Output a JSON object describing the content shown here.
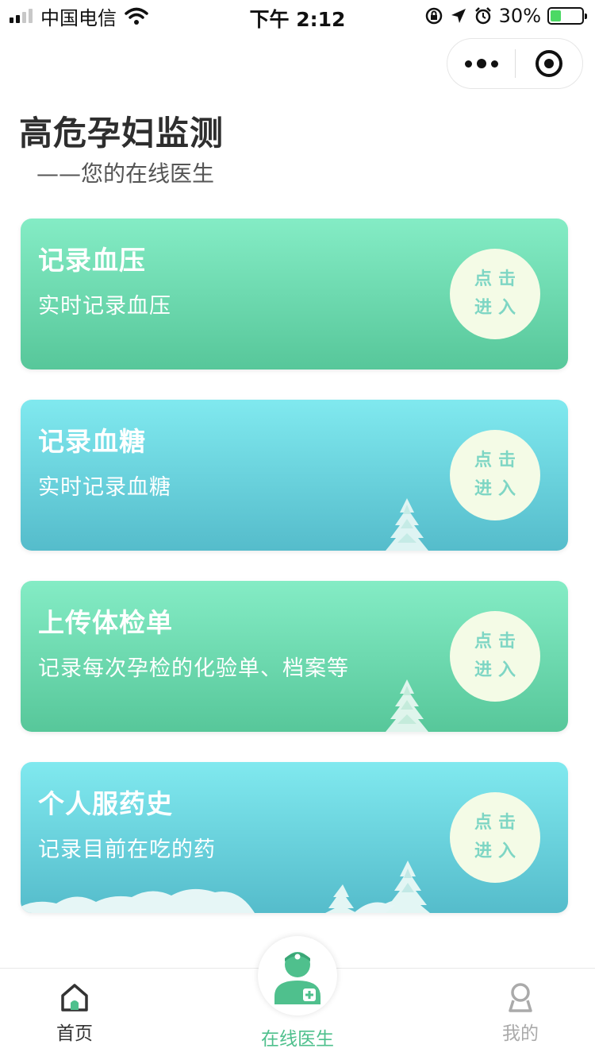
{
  "status_bar": {
    "carrier": "中国电信",
    "time": "下午 2:12",
    "battery": "30%",
    "battery_level": 0.3,
    "icons": [
      "signal-icon",
      "wifi-icon",
      "rotation-lock-icon",
      "location-icon",
      "alarm-icon",
      "battery-icon"
    ]
  },
  "capsule": {
    "icons": [
      "more-icon",
      "close-miniprogram-icon"
    ]
  },
  "header": {
    "title": "高危孕妇监测",
    "subtitle": "——您的在线医生"
  },
  "cards": [
    {
      "title": "记录血压",
      "desc": "实时记录血压",
      "btn_line1": "点击",
      "btn_line2": "进入",
      "color": "green"
    },
    {
      "title": "记录血糖",
      "desc": "实时记录血糖",
      "btn_line1": "点击",
      "btn_line2": "进入",
      "color": "blue"
    },
    {
      "title": "上传体检单",
      "desc": "记录每次孕检的化验单、档案等",
      "btn_line1": "点击",
      "btn_line2": "进入",
      "color": "green"
    },
    {
      "title": "个人服药史",
      "desc": "记录目前在吃的药",
      "btn_line1": "点击",
      "btn_line2": "进入",
      "color": "blue"
    }
  ],
  "tabbar": {
    "home": "首页",
    "doctor": "在线医生",
    "mine": "我的"
  },
  "colors": {
    "green_top": "#84ecc5",
    "green_bottom": "#57c79a",
    "blue_top": "#80e9ef",
    "blue_bottom": "#55bccb",
    "button_bg": "#f4fbe6",
    "button_text": "#7ed6c4",
    "accent": "#4fc08d"
  }
}
